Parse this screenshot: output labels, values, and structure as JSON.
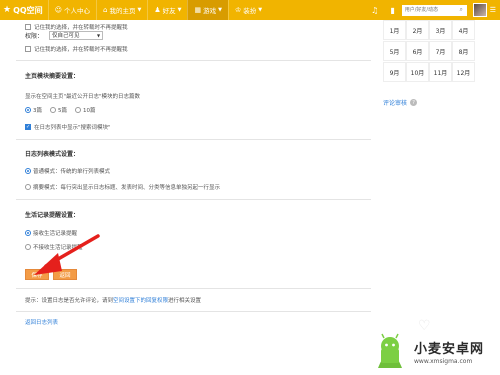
{
  "topbar": {
    "brand": "QQ空间",
    "nav": [
      {
        "icon": "person-icon",
        "label": "个人中心",
        "active": false
      },
      {
        "icon": "home-icon",
        "label": "我的主页",
        "active": false,
        "chevron": true
      },
      {
        "icon": "friends-icon",
        "label": "好友",
        "active": false,
        "chevron": true
      },
      {
        "icon": "game-icon",
        "label": "游戏",
        "active": true,
        "chevron": true
      },
      {
        "icon": "shirt-icon",
        "label": "装扮",
        "active": false,
        "chevron": true
      }
    ],
    "search_placeholder": "用户/好友/动态"
  },
  "form": {
    "remember_label": "记住我的选择，并在转载时不再提醒我",
    "permission_label": "权限：",
    "permission_value": "仅自己可见",
    "module": {
      "title": "主页模块摘要设置：",
      "desc": "显示在空间主页\"最近公开日志\"模块的日志篇数",
      "options": [
        "3篇",
        "5篇",
        "10篇"
      ],
      "selected": 0,
      "search_module_label": "在日志列表中显示\"搜索词模块\""
    },
    "list_mode": {
      "title": "日志列表模式设置：",
      "options": [
        "普通模式：传统的单行列表模式",
        "摘要模式：每行突出显示日志标题、发表时间、分类等信息单独另起一行显示"
      ],
      "selected": 0
    },
    "reminder": {
      "title": "生活记录提醒设置：",
      "options": [
        "接收生活记录提醒",
        "不接收生活记录提醒"
      ],
      "selected": 0
    },
    "save_label": "保存",
    "cancel_label": "返回",
    "tip_prefix": "提示：设置日志是否允许评论，请到",
    "tip_link": "空间设置下的回复权限",
    "tip_suffix": "进行相关设置",
    "back_link": "返回日志列表"
  },
  "calendar": {
    "months": [
      "1月",
      "2月",
      "3月",
      "4月",
      "5月",
      "6月",
      "7月",
      "8月",
      "9月",
      "10月",
      "11月",
      "12月"
    ]
  },
  "sidebar": {
    "comment_label": "评论审核",
    "help_icon": "?"
  },
  "watermark": {
    "title": "小麦安卓网",
    "url": "www.xmsigma.com"
  },
  "colors": {
    "topbar": "#f1b400",
    "button": "#f39c47",
    "link": "#2f7fd8",
    "arrow": "#e5201c"
  }
}
